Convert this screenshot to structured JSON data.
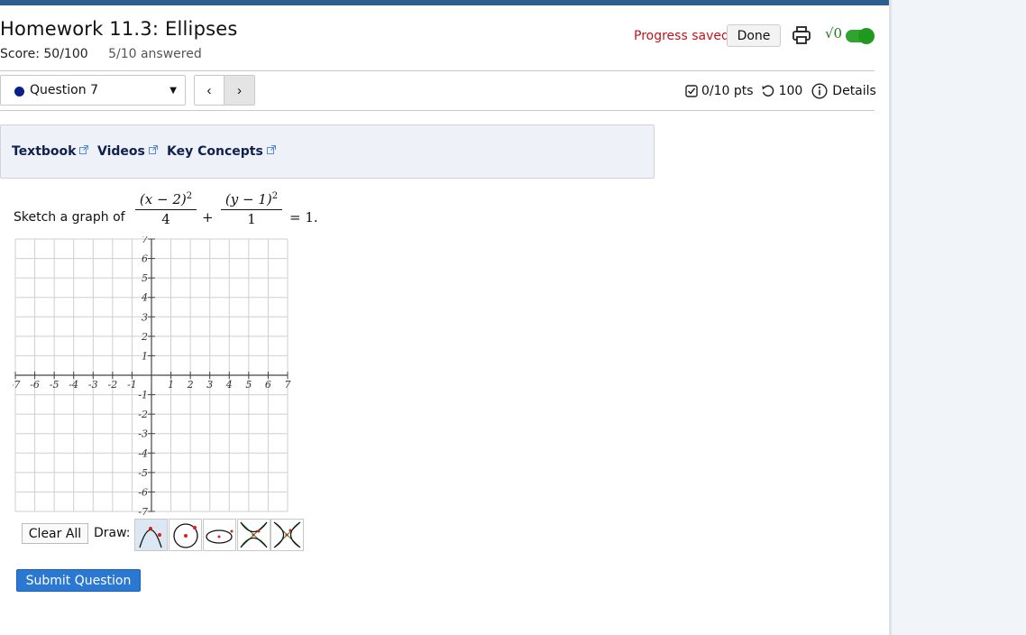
{
  "header": {
    "title": "Homework 11.3: Ellipses",
    "score": "Score: 50/100",
    "answered": "5/10 answered",
    "progress_saved": "Progress saved",
    "done_label": "Done",
    "print_icon": "print-icon",
    "math_icon": "√0",
    "toggle_on": true
  },
  "nav": {
    "question_label": "Question 7",
    "prev_label": "‹",
    "next_label": "›",
    "points": "0/10 pts",
    "attempts": "100",
    "details_label": "Details"
  },
  "resources": [
    {
      "label": "Textbook"
    },
    {
      "label": "Videos"
    },
    {
      "label": "Key Concepts"
    }
  ],
  "question": {
    "prompt": "Sketch a graph of",
    "eq_num1_open": "(x − 2)",
    "eq_num1_exp": "2",
    "eq_den1": "4",
    "eq_plus": "+",
    "eq_num2_open": "(y − 1)",
    "eq_num2_exp": "2",
    "eq_den2": "1",
    "eq_rhs": "= 1."
  },
  "graph": {
    "x_ticks": [
      "-7",
      "-6",
      "-5",
      "-4",
      "-3",
      "-2",
      "-1",
      "1",
      "2",
      "3",
      "4",
      "5",
      "6",
      "7"
    ],
    "y_ticks": [
      "7",
      "6",
      "5",
      "4",
      "3",
      "2",
      "1",
      "-1",
      "-2",
      "-3",
      "-4",
      "-5",
      "-6",
      "-7"
    ],
    "x_range": [
      -7,
      7
    ],
    "y_range": [
      -7,
      7
    ]
  },
  "tools": {
    "clear_all_label": "Clear All",
    "draw_label": "Draw:",
    "items": [
      "parabola-tool",
      "circle-tool",
      "ellipse-tool",
      "hyperbola-vertical-tool",
      "hyperbola-horizontal-tool"
    ]
  },
  "submit_label": "Submit Question",
  "colors": {
    "topbar": "#2e5e8f",
    "progress_saved": "#c0141e",
    "submit": "#2a78d2",
    "toggle": "#2fa52f",
    "question_dot": "#0b1f8a"
  }
}
